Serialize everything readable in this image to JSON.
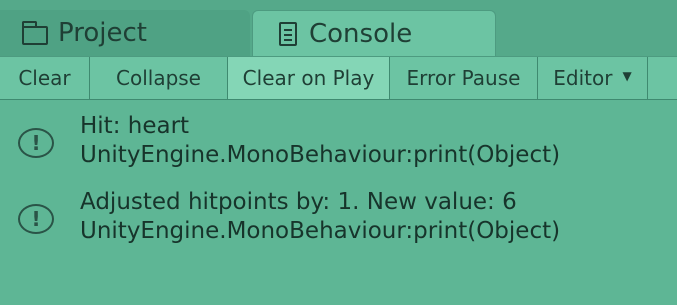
{
  "tabs": {
    "project": {
      "label": "Project",
      "icon": "folder-icon"
    },
    "console": {
      "label": "Console",
      "icon": "document-icon",
      "active": true
    }
  },
  "toolbar": {
    "clear": "Clear",
    "collapse": "Collapse",
    "clear_on_play": "Clear on Play",
    "error_pause": "Error Pause",
    "editor": "Editor"
  },
  "log": [
    {
      "icon": "info-icon",
      "line1": "Hit: heart",
      "line2": "UnityEngine.MonoBehaviour:print(Object)"
    },
    {
      "icon": "info-icon",
      "line1": "Adjusted hitpoints by: 1. New value: 6",
      "line2": "UnityEngine.MonoBehaviour:print(Object)"
    }
  ],
  "colors": {
    "background": "#5eb695",
    "tab_active": "#6cc4a3",
    "text": "#17342b"
  }
}
